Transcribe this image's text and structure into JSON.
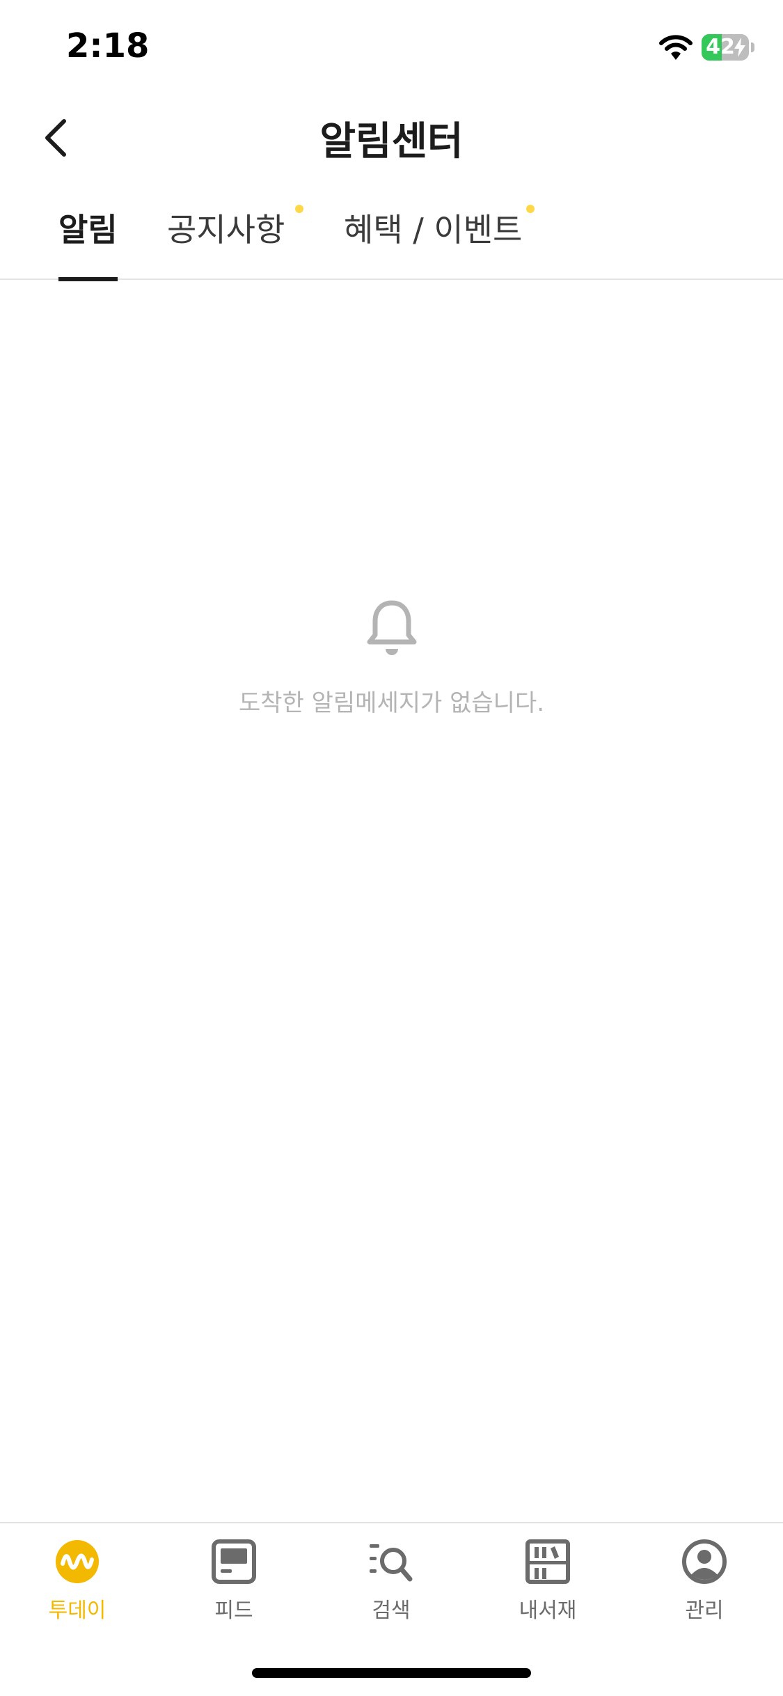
{
  "status_bar": {
    "time": "2:18",
    "battery_level": "42",
    "battery_fraction": 0.42,
    "wifi_icon": "wifi-icon",
    "charging_icon": "bolt-icon"
  },
  "header": {
    "title": "알림센터",
    "back_icon": "chevron-left-icon"
  },
  "tabs": [
    {
      "label": "알림",
      "active": true,
      "has_dot": false
    },
    {
      "label": "공지사항",
      "active": false,
      "has_dot": true
    },
    {
      "label": "혜택 / 이벤트",
      "active": false,
      "has_dot": true
    }
  ],
  "empty_state": {
    "icon": "bell-icon",
    "message": "도착한 알림메세지가 없습니다."
  },
  "bottom_nav": [
    {
      "label": "투데이",
      "icon": "today-wave-icon",
      "active": true
    },
    {
      "label": "피드",
      "icon": "feed-icon",
      "active": false
    },
    {
      "label": "검색",
      "icon": "search-list-icon",
      "active": false
    },
    {
      "label": "내서재",
      "icon": "bookshelf-icon",
      "active": false
    },
    {
      "label": "관리",
      "icon": "profile-icon",
      "active": false
    }
  ],
  "colors": {
    "accent": "#f3b800",
    "tab_dot": "#ffd84a",
    "battery_green": "#34c759",
    "text_primary": "#1c1c1c",
    "text_muted": "#b4b4b4",
    "icon_gray": "#6b6b6b"
  }
}
